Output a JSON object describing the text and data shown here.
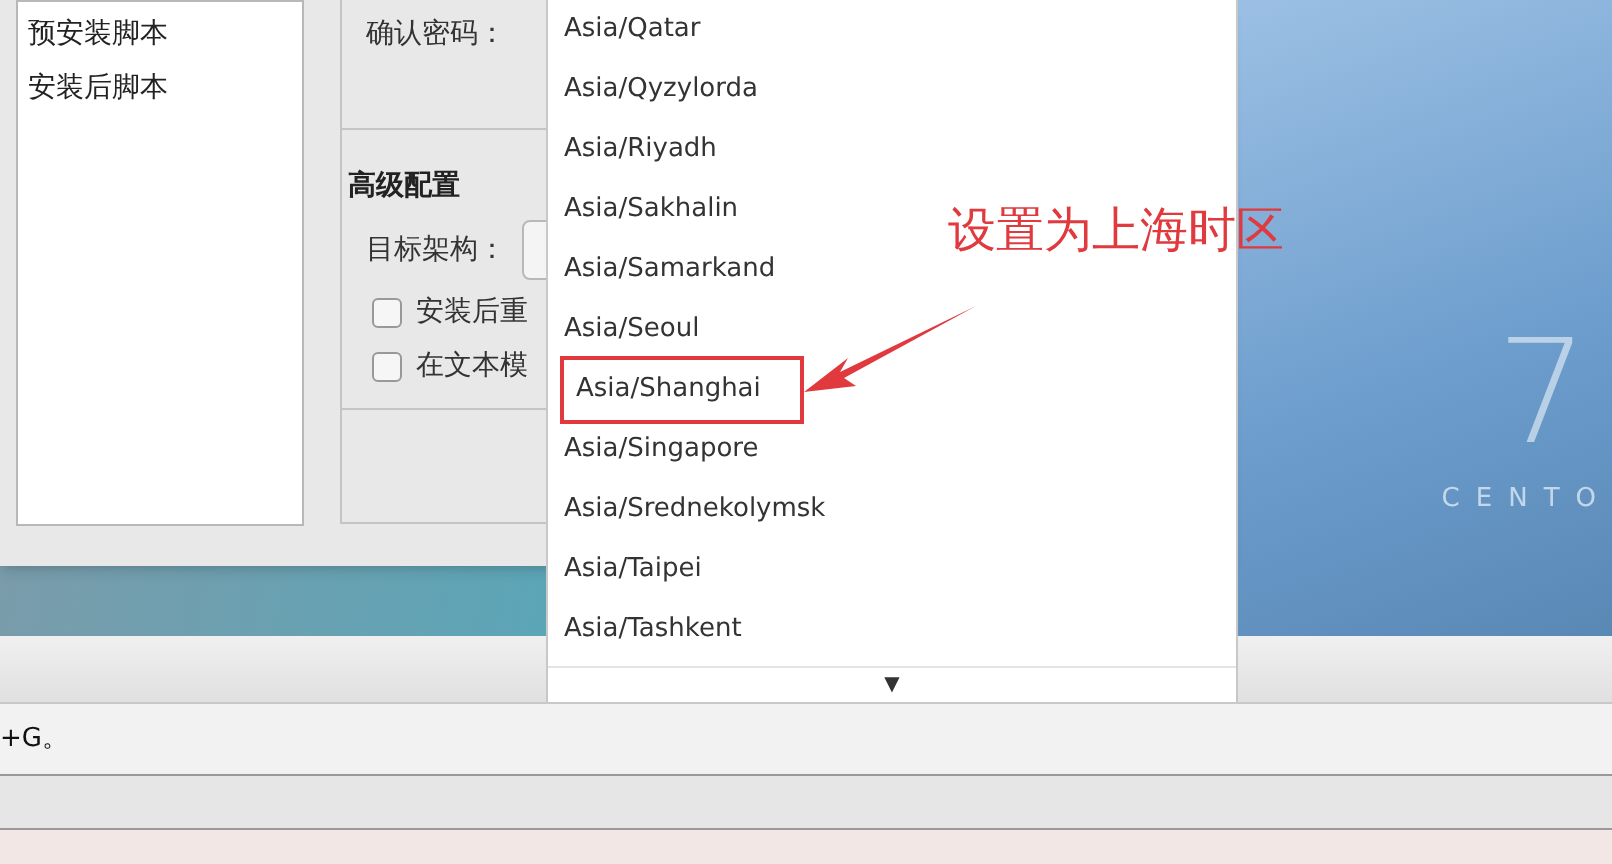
{
  "sidebar": {
    "items": [
      {
        "label": "预安装脚本"
      },
      {
        "label": "安装后脚本"
      }
    ]
  },
  "password_section": {
    "confirm_label": "确认密码："
  },
  "advanced": {
    "title": "高级配置",
    "arch_label": "目标架构：",
    "options": [
      {
        "label": "安装后重",
        "checked": false
      },
      {
        "label": "在文本模",
        "checked": false
      }
    ]
  },
  "timezone_list": {
    "items": [
      {
        "label": "Asia/Qatar",
        "highlighted": false
      },
      {
        "label": "Asia/Qyzylorda",
        "highlighted": false
      },
      {
        "label": "Asia/Riyadh",
        "highlighted": false
      },
      {
        "label": "Asia/Sakhalin",
        "highlighted": false
      },
      {
        "label": "Asia/Samarkand",
        "highlighted": false
      },
      {
        "label": "Asia/Seoul",
        "highlighted": false
      },
      {
        "label": "Asia/Shanghai",
        "highlighted": true
      },
      {
        "label": "Asia/Singapore",
        "highlighted": false
      },
      {
        "label": "Asia/Srednekolymsk",
        "highlighted": false
      },
      {
        "label": "Asia/Taipei",
        "highlighted": false
      },
      {
        "label": "Asia/Tashkent",
        "highlighted": false
      }
    ],
    "scroll_arrow": "▼"
  },
  "annotation": {
    "text": "设置为上海时区"
  },
  "desktop": {
    "logo_number": "7",
    "logo_text": "CENTO"
  },
  "status_text": "+G。"
}
